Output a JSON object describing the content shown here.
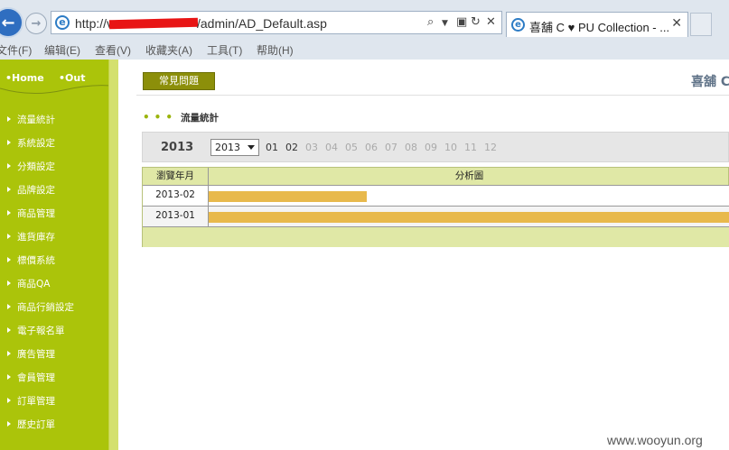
{
  "browser": {
    "url_prefix": "http://v",
    "url_suffix": "/admin/AD_Default.asp",
    "tab_title": "喜舖 C ♥ PU Collection - ...",
    "menu": [
      "文件(F)",
      "编辑(E)",
      "查看(V)",
      "收藏夹(A)",
      "工具(T)",
      "帮助(H)"
    ]
  },
  "sidebar": {
    "top_links": [
      "Home",
      "Out"
    ],
    "items": [
      "流量統計",
      "系統設定",
      "分類設定",
      "品牌設定",
      "商品管理",
      "進貨庫存",
      "標價系統",
      "商品QA",
      "商品行銷設定",
      "電子報名單",
      "廣告管理",
      "會員管理",
      "訂單管理",
      "歷史訂單"
    ]
  },
  "main": {
    "faq_label": "常見問題",
    "brand": "喜舖 C",
    "section_title": "流量統計",
    "year_label": "2013",
    "year_select": "2013",
    "months": [
      "01",
      "02",
      "03",
      "04",
      "05",
      "06",
      "07",
      "08",
      "09",
      "10",
      "11",
      "12"
    ],
    "active_months": [
      "01",
      "02"
    ],
    "table": {
      "headers": [
        "瀏覽年月",
        "分析圖"
      ],
      "rows": [
        {
          "month": "2013-02",
          "bar_fraction": 0.3
        },
        {
          "month": "2013-01",
          "bar_fraction": 1.0
        }
      ]
    }
  },
  "colors": {
    "sidebar": "#abc40a",
    "faq_button": "#8c8f0a",
    "bar": "#e8b94c",
    "back_button": "#2f6ec0",
    "redaction": "#e81515"
  },
  "watermark": "www.wooyun.org"
}
